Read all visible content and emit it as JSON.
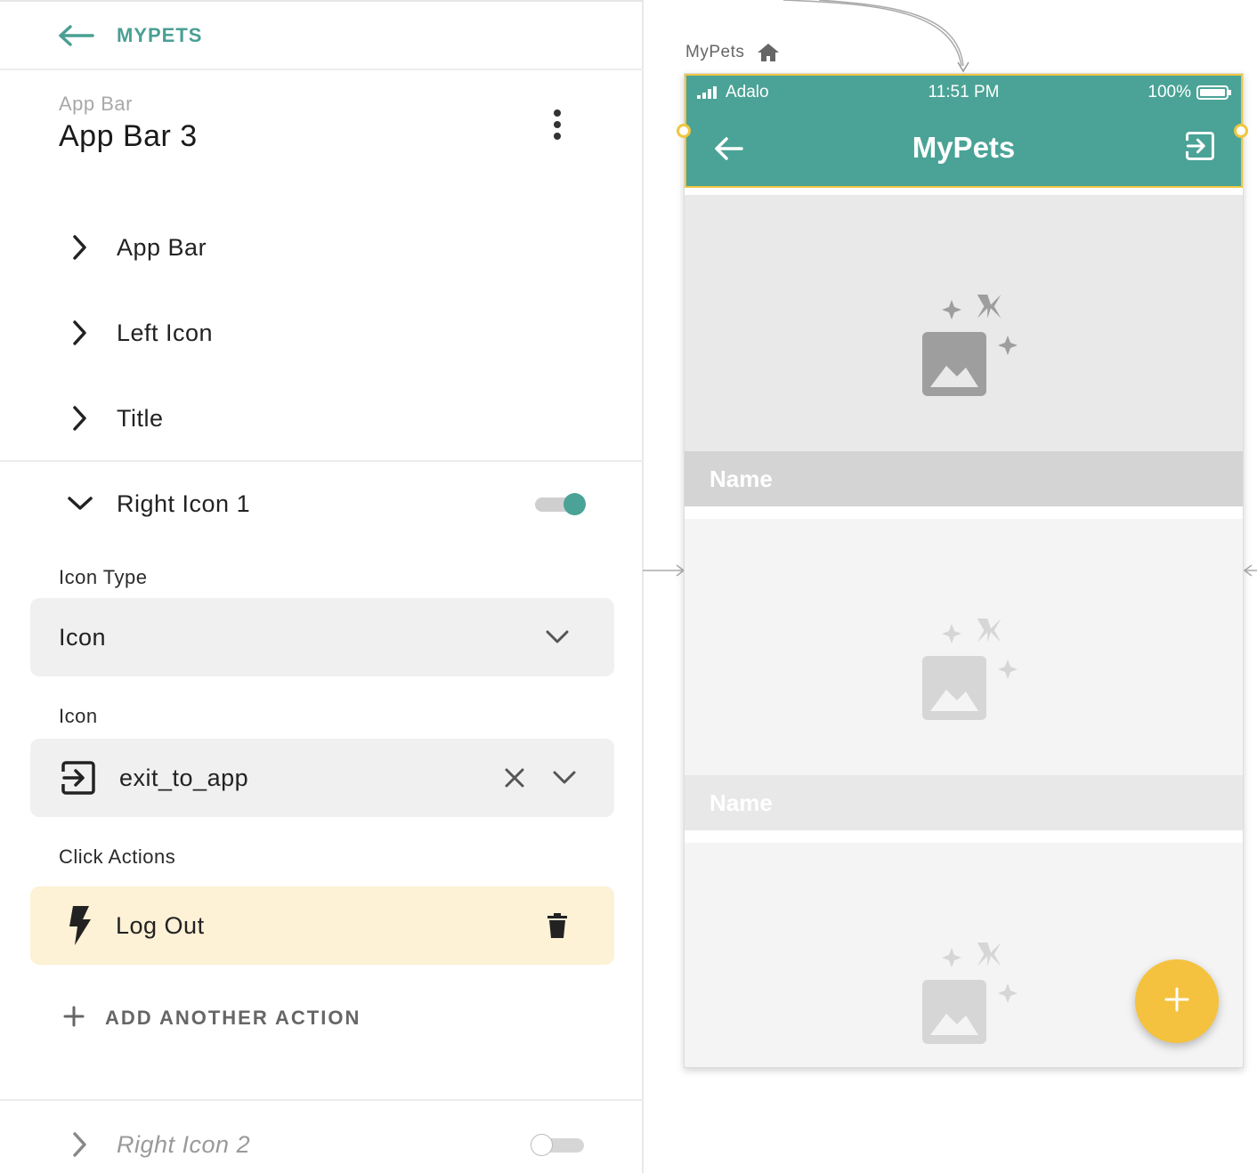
{
  "nav": {
    "back_label": "MYPETS"
  },
  "component": {
    "type_label": "App Bar",
    "name": "App Bar 3"
  },
  "sections": {
    "app_bar": "App Bar",
    "left_icon": "Left Icon",
    "title": "Title",
    "right_icon_1": "Right Icon 1",
    "right_icon_2": "Right Icon 2"
  },
  "toggles": {
    "right_icon_1_enabled": true,
    "right_icon_2_enabled": false
  },
  "right_icon_1": {
    "icon_type_label": "Icon Type",
    "icon_type_value": "Icon",
    "icon_label": "Icon",
    "icon_value": "exit_to_app",
    "click_actions_label": "Click Actions",
    "actions": [
      "Log Out"
    ],
    "add_action_label": "ADD ANOTHER ACTION"
  },
  "canvas": {
    "screen_name": "MyPets",
    "status_bar": {
      "carrier": "Adalo",
      "time": "11:51 PM",
      "battery": "100%"
    },
    "app_bar_title": "MyPets",
    "cards": [
      {
        "name": "Name"
      },
      {
        "name": "Name"
      },
      {
        "name": ""
      }
    ]
  },
  "colors": {
    "accent": "#4aa396",
    "selection": "#f0c540",
    "fab": "#f4c23e",
    "action_bg": "#fdf1d6"
  }
}
